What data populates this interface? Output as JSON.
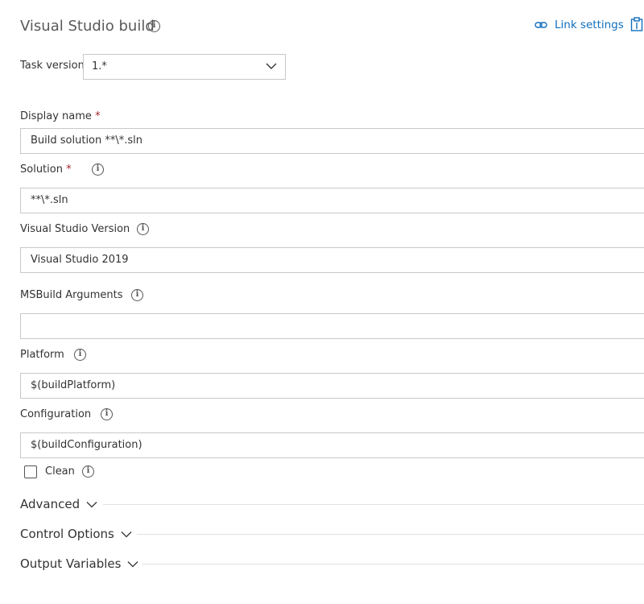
{
  "header": {
    "title": "Visual Studio build",
    "link_settings": "Link settings",
    "icons": [
      "info-icon",
      "link-icon",
      "clipboard-icon"
    ]
  },
  "task_version": {
    "label": "Task version",
    "value": "1.*"
  },
  "fields": {
    "display_name": {
      "label": "Display name",
      "required": "*",
      "value": "Build solution **\\*.sln"
    },
    "solution": {
      "label": "Solution",
      "required": "*",
      "value": "**\\*.sln"
    },
    "vs_version": {
      "label": "Visual Studio Version",
      "value": "Visual Studio 2019"
    },
    "msbuild_args": {
      "label": "MSBuild Arguments",
      "value": ""
    },
    "platform": {
      "label": "Platform",
      "value": "$(buildPlatform)"
    },
    "configuration": {
      "label": "Configuration",
      "value": "$(buildConfiguration)"
    }
  },
  "clean": {
    "label": "Clean",
    "checked": false
  },
  "sections": {
    "advanced": "Advanced",
    "control_options": "Control Options",
    "output_variables": "Output Variables"
  },
  "colors": {
    "link": "#106ebe",
    "required": "#a4262c",
    "border": "#c8c8c8"
  }
}
